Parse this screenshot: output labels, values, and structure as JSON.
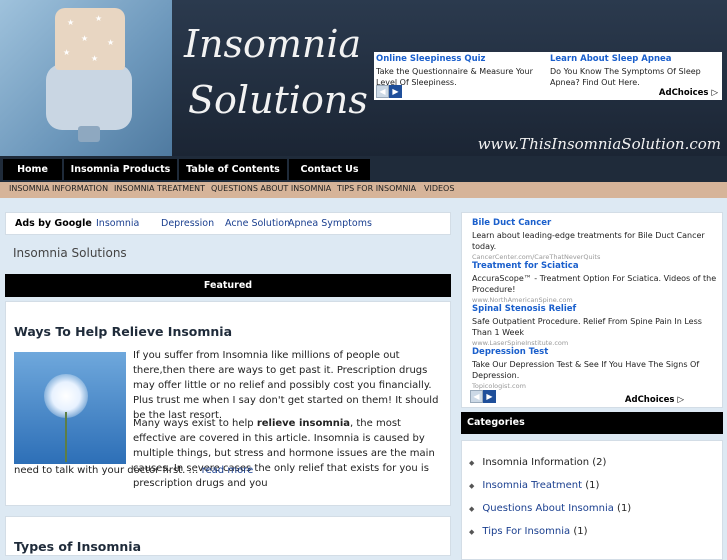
{
  "header": {
    "title_line1": "Insomnia",
    "title_line2": "Solutions",
    "site_url": "www.ThisInsomniaSolution.com"
  },
  "top_ad": {
    "items": [
      {
        "title": "Online Sleepiness Quiz",
        "text": "Take the Questionnaire & Measure Your Level Of Sleepiness."
      },
      {
        "title": "Learn About Sleep Apnea",
        "text": "Do You Know The Symptoms Of Sleep Apnea? Find Out Here."
      }
    ],
    "adchoices": "AdChoices"
  },
  "nav": {
    "items": [
      "Home",
      "Insomnia Products",
      "Table of Contents",
      "Contact Us"
    ]
  },
  "categories_bar": {
    "items": [
      "INSOMNIA INFORMATION",
      "INSOMNIA TREATMENT",
      "QUESTIONS ABOUT INSOMNIA",
      "TIPS FOR INSOMNIA",
      "VIDEOS"
    ]
  },
  "ads_row": {
    "label": "Ads by Google",
    "links": [
      "Insomnia",
      "Depression",
      "Acne Solution",
      "Apnea Symptoms"
    ]
  },
  "breadcrumb": "Insomnia Solutions",
  "featured_label": "Featured",
  "post": {
    "title": "Ways To Help Relieve Insomnia",
    "para1": "If you suffer from Insomnia like millions of people out there,then there are ways to get past it. Prescription drugs may offer little or no relief and possibly cost you financially. Plus trust me when I say don't get started on them! It should be the last resort.",
    "para2_start": "Many ways exist to help ",
    "para2_bold": "relieve insomnia",
    "para2_end": ", the most effective are covered in this article. Insomnia is caused by multiple things, but stress and hormone issues are the main causes. In severe cases the only relief that exists for you is prescription drugs and you",
    "para3": "need to talk with your doctor first. … ",
    "read_more": "read more"
  },
  "post2": {
    "title": "Types of Insomnia"
  },
  "side_ad": {
    "items": [
      {
        "title": "Bile Duct Cancer",
        "text": "Learn about leading-edge treatments for Bile Duct Cancer today.",
        "url": "CancerCenter.com/CareThatNeverQuits"
      },
      {
        "title": "Treatment for Sciatica",
        "text": "AccuraScope™ - Treatment Option For Sciatica. Videos of the Procedure!",
        "url": "www.NorthAmericanSpine.com"
      },
      {
        "title": "Spinal Stenosis Relief",
        "text": "Safe Outpatient Procedure. Relief From Spine Pain In Less Than 1 Week",
        "url": "www.LaserSpineInstitute.com"
      },
      {
        "title": "Depression Test",
        "text": "Take Our Depression Test & See If You Have The Signs Of Depression.",
        "url": "Topicologist.com"
      }
    ],
    "adchoices": "AdChoices"
  },
  "categories": {
    "title": "Categories",
    "items": [
      {
        "name": "Insomnia Information",
        "count": "(2)"
      },
      {
        "name": "Insomnia Treatment",
        "count": "(1)"
      },
      {
        "name": "Questions About Insomnia",
        "count": "(1)"
      },
      {
        "name": "Tips For Insomnia",
        "count": "(1)"
      }
    ]
  }
}
